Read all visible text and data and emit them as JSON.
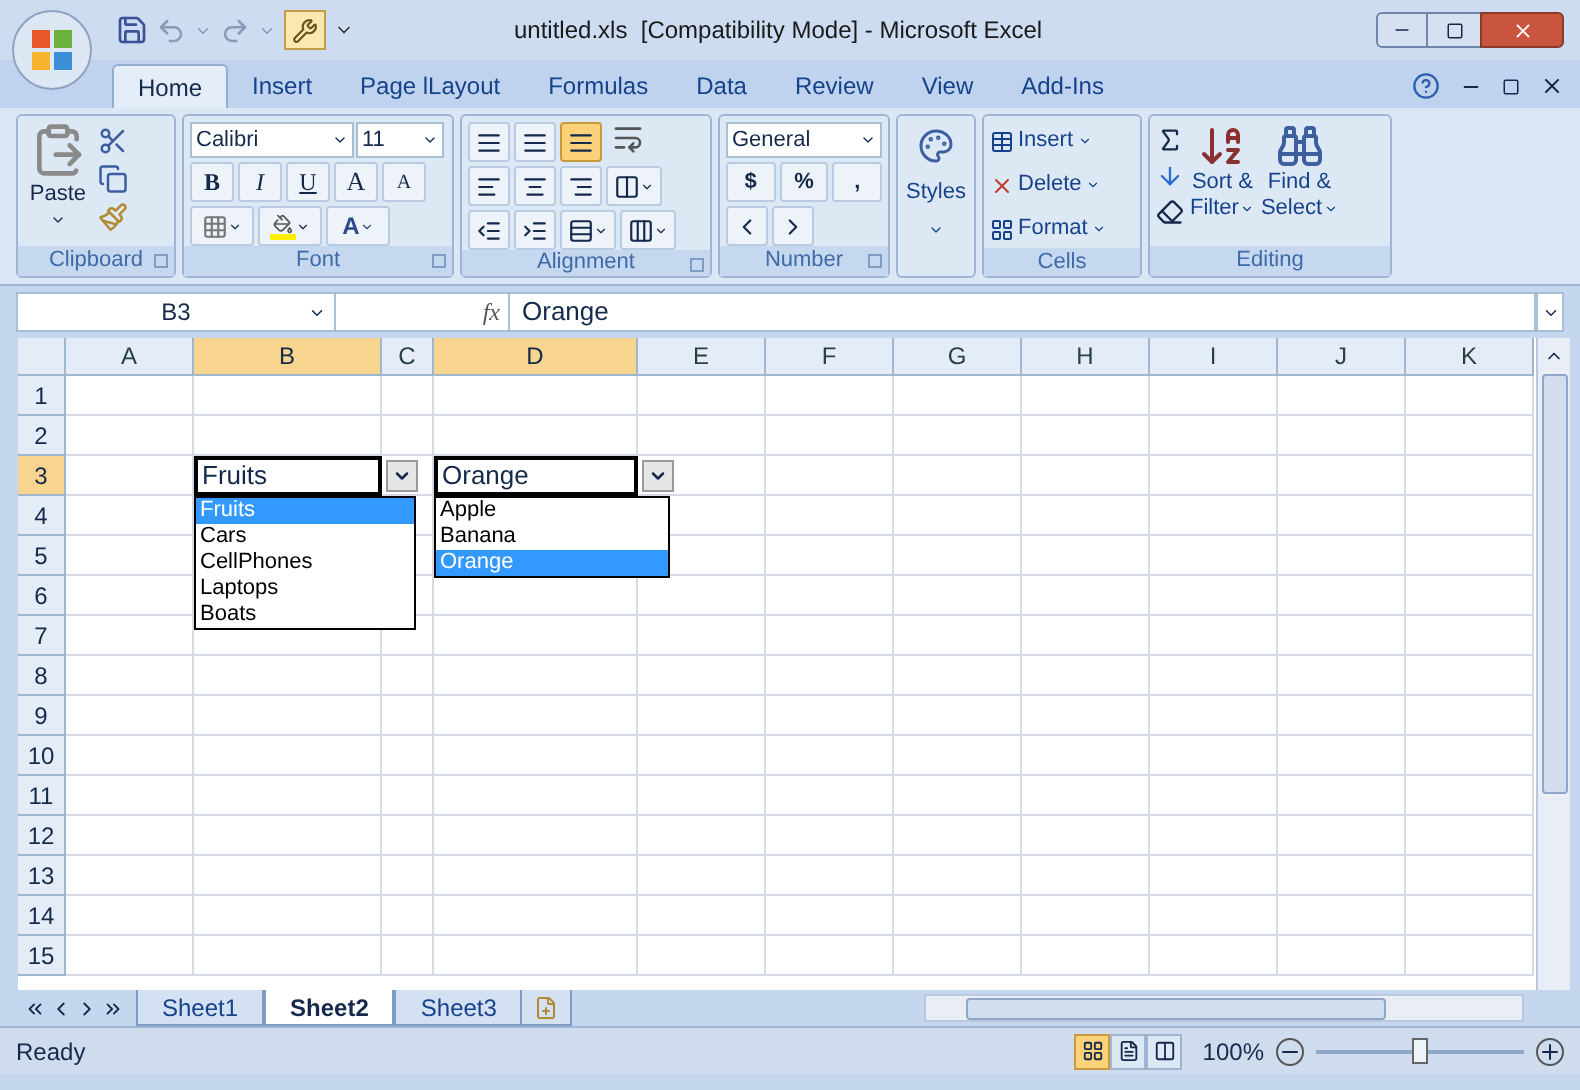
{
  "window": {
    "title": "untitled.xls  [Compatibility Mode] - Microsoft Excel"
  },
  "ribbon_tabs": [
    {
      "label": "Home",
      "selected": true
    },
    {
      "label": "Insert",
      "selected": false
    },
    {
      "label": "Page lLayout",
      "selected": false
    },
    {
      "label": "Formulas",
      "selected": false
    },
    {
      "label": "Data",
      "selected": false
    },
    {
      "label": "Review",
      "selected": false
    },
    {
      "label": "View",
      "selected": false
    },
    {
      "label": "Add-Ins",
      "selected": false
    }
  ],
  "ribbon": {
    "clipboard": {
      "label": "Clipboard",
      "paste": "Paste"
    },
    "font": {
      "label": "Font",
      "font_name": "Calibri",
      "font_size": "11",
      "style_buttons": [
        "B",
        "I",
        "U"
      ],
      "grow_shrink": [
        "A",
        "A"
      ],
      "font_color": "A"
    },
    "alignment": {
      "label": "Alignment"
    },
    "number": {
      "label": "Number",
      "format": "General",
      "symbols": [
        "$",
        "%",
        ","
      ]
    },
    "styles": {
      "label": "Styles"
    },
    "cells": {
      "label": "Cells",
      "buttons": [
        "Insert",
        "Delete",
        "Format"
      ]
    },
    "editing": {
      "label": "Editing",
      "sort": [
        "Sort &",
        "Filter"
      ],
      "find": [
        "Find &",
        "Select"
      ]
    }
  },
  "formula_bar": {
    "name_box": "B3",
    "fx": "fx",
    "value": "Orange"
  },
  "columns": [
    {
      "label": "A",
      "selected": false
    },
    {
      "label": "B",
      "selected": true
    },
    {
      "label": "C",
      "selected": false
    },
    {
      "label": "D",
      "selected": true
    },
    {
      "label": "E",
      "selected": false
    },
    {
      "label": "F",
      "selected": false
    },
    {
      "label": "G",
      "selected": false
    },
    {
      "label": "H",
      "selected": false
    },
    {
      "label": "I",
      "selected": false
    },
    {
      "label": "J",
      "selected": false
    },
    {
      "label": "K",
      "selected": false
    }
  ],
  "rows": [
    {
      "label": "1",
      "selected": false
    },
    {
      "label": "2",
      "selected": false
    },
    {
      "label": "3",
      "selected": true
    },
    {
      "label": "4",
      "selected": false
    },
    {
      "label": "5",
      "selected": false
    },
    {
      "label": "6",
      "selected": false
    },
    {
      "label": "7",
      "selected": false
    },
    {
      "label": "8",
      "selected": false
    },
    {
      "label": "9",
      "selected": false
    },
    {
      "label": "10",
      "selected": false
    },
    {
      "label": "11",
      "selected": false
    },
    {
      "label": "12",
      "selected": false
    },
    {
      "label": "13",
      "selected": false
    },
    {
      "label": "14",
      "selected": false
    },
    {
      "label": "15",
      "selected": false
    }
  ],
  "dropdowns": [
    {
      "value": "Fruits",
      "options": [
        {
          "label": "Fruits",
          "selected": true
        },
        {
          "label": "Cars",
          "selected": false
        },
        {
          "label": "CellPhones",
          "selected": false
        },
        {
          "label": "Laptops",
          "selected": false
        },
        {
          "label": "Boats",
          "selected": false
        }
      ]
    },
    {
      "value": "Orange",
      "options": [
        {
          "label": "Apple",
          "selected": false
        },
        {
          "label": "Banana",
          "selected": false
        },
        {
          "label": "Orange",
          "selected": true
        }
      ]
    }
  ],
  "sheets": [
    {
      "label": "Sheet1",
      "selected": false
    },
    {
      "label": "Sheet2",
      "selected": true
    },
    {
      "label": "Sheet3",
      "selected": false
    }
  ],
  "status_bar": {
    "text": "Ready",
    "views": [
      {
        "kind": "normal",
        "selected": true
      },
      {
        "kind": "page_layout",
        "selected": false
      },
      {
        "kind": "page_break",
        "selected": false
      }
    ],
    "zoom": "100%",
    "zoom_slider": {
      "level": 0.5
    }
  }
}
